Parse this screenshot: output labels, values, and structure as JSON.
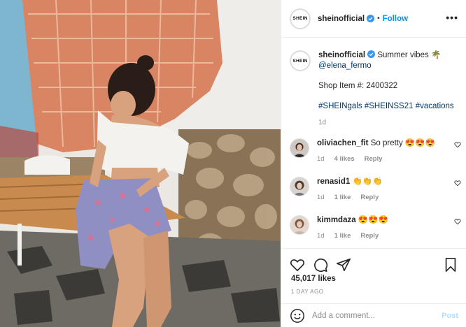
{
  "post": {
    "username": "sheinofficial",
    "follow_label": "Follow",
    "more_label": "•••",
    "brand_logo_text": "SHEIN"
  },
  "caption": {
    "username": "sheinofficial",
    "text": "Summer vibes 🌴",
    "mention": "@elena_fermo",
    "shop_item": "Shop Item #: 2400322",
    "hashtags": "#SHEINgals #SHEINSS21 #vacations",
    "time": "1d"
  },
  "comments": [
    {
      "username": "oliviachen_fit",
      "text": "So pretty 😍😍😍",
      "time": "1d",
      "likes": "4 likes",
      "reply": "Reply"
    },
    {
      "username": "renasid1",
      "text": "👏👏👏",
      "time": "1d",
      "likes": "1 like",
      "reply": "Reply"
    },
    {
      "username": "kimmdaza",
      "text": "😍😍😍",
      "time": "1d",
      "likes": "1 like",
      "reply": "Reply"
    }
  ],
  "actions": {
    "likes": "45,017 likes",
    "ago": "1 DAY AGO",
    "add_comment_placeholder": "Add a comment...",
    "post_label": "Post"
  },
  "icons": [
    "verified-badge-icon",
    "more-options-icon",
    "heart-icon",
    "comment-icon",
    "share-icon",
    "bookmark-icon",
    "emoji-icon"
  ],
  "colors": {
    "accent": "#0095f6",
    "muted": "#8e8e8e",
    "post_disabled": "#b2dffc",
    "link": "#00376b"
  }
}
